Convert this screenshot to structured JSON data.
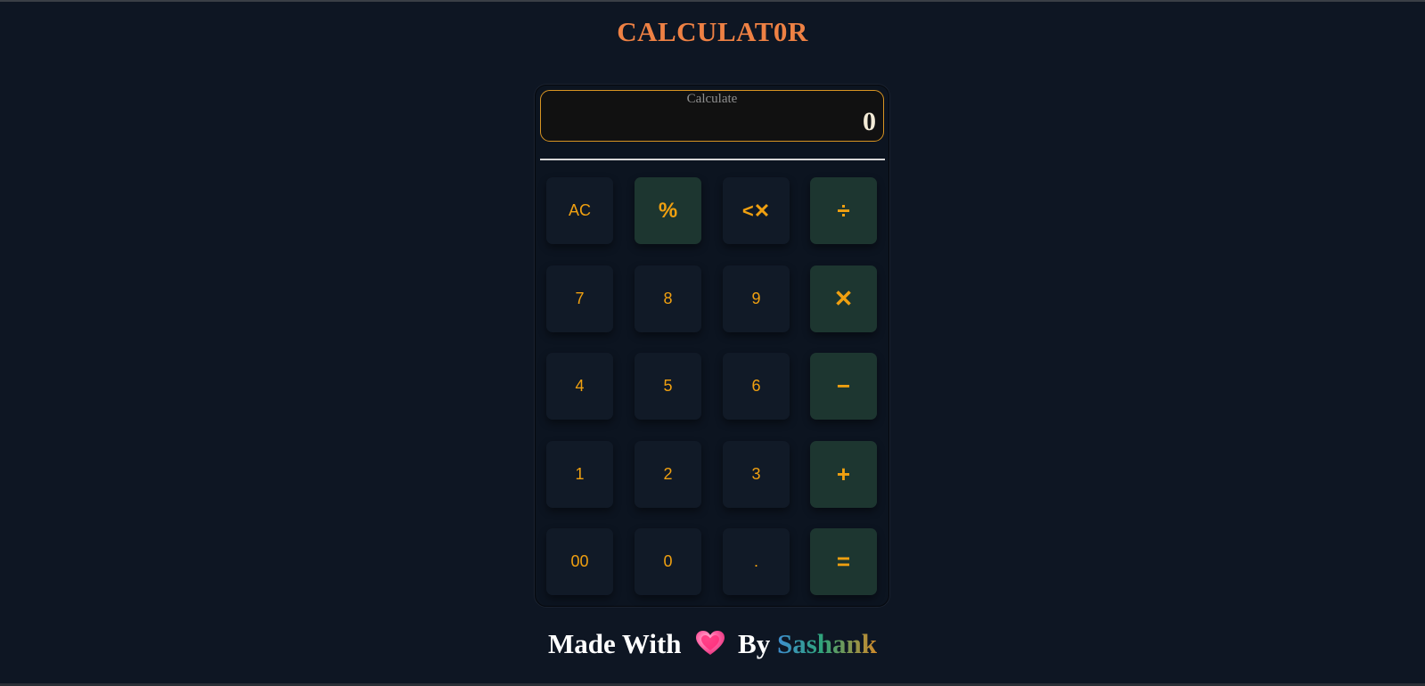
{
  "title": "CALCULAT0R",
  "display": {
    "label": "Calculate",
    "value": "0"
  },
  "keys": [
    {
      "label": "AC",
      "name": "all-clear-button",
      "type": "func"
    },
    {
      "label": "%",
      "name": "percent-button",
      "type": "op"
    },
    {
      "label": "<✕",
      "name": "backspace-button",
      "type": "func"
    },
    {
      "label": "÷",
      "name": "divide-button",
      "type": "op"
    },
    {
      "label": "7",
      "name": "digit-7-button",
      "type": "digit"
    },
    {
      "label": "8",
      "name": "digit-8-button",
      "type": "digit"
    },
    {
      "label": "9",
      "name": "digit-9-button",
      "type": "digit"
    },
    {
      "label": "✕",
      "name": "multiply-button",
      "type": "op"
    },
    {
      "label": "4",
      "name": "digit-4-button",
      "type": "digit"
    },
    {
      "label": "5",
      "name": "digit-5-button",
      "type": "digit"
    },
    {
      "label": "6",
      "name": "digit-6-button",
      "type": "digit"
    },
    {
      "label": "−",
      "name": "subtract-button",
      "type": "op"
    },
    {
      "label": "1",
      "name": "digit-1-button",
      "type": "digit"
    },
    {
      "label": "2",
      "name": "digit-2-button",
      "type": "digit"
    },
    {
      "label": "3",
      "name": "digit-3-button",
      "type": "digit"
    },
    {
      "label": "+",
      "name": "add-button",
      "type": "op"
    },
    {
      "label": "00",
      "name": "double-zero-button",
      "type": "digit"
    },
    {
      "label": "0",
      "name": "digit-0-button",
      "type": "digit"
    },
    {
      "label": ".",
      "name": "decimal-button",
      "type": "digit"
    },
    {
      "label": "=",
      "name": "equals-button",
      "type": "op"
    }
  ],
  "footer": {
    "made_with": "Made With",
    "heart_icon": "pink-heart-icon",
    "by": "By",
    "author": "Sashank"
  },
  "colors": {
    "background": "#0e1623",
    "accent": "#f0a010",
    "title": "#ee8144",
    "operator_key": "#1d3630",
    "digit_key": "#111a27",
    "display_border": "#d89422"
  }
}
